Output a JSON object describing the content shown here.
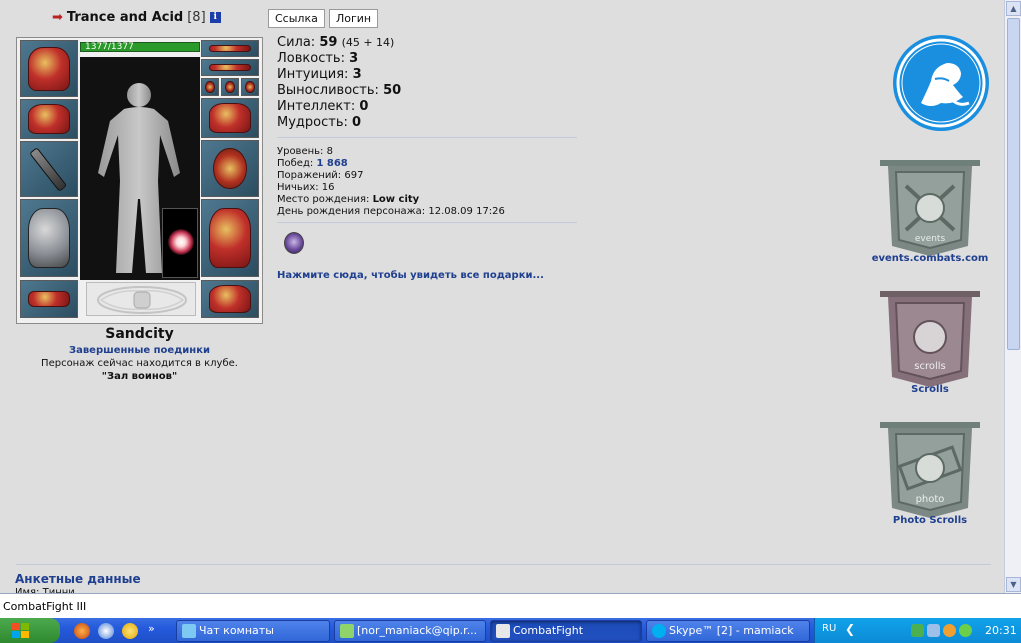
{
  "header": {
    "name": "Trance and Acid",
    "level": "[8]",
    "info_glyph": "i",
    "link_button": "Ссылка",
    "login_button": "Логин"
  },
  "equipment": {
    "hp": "1377/1377"
  },
  "location": {
    "name": "Sandcity",
    "finished_fights": "Завершенные поединки",
    "status": "Персонаж сейчас находится в клубе.",
    "hall": "\"Зал воинов\""
  },
  "stats": [
    {
      "label": "Сила:",
      "value": "59",
      "extra": "(45 + 14)"
    },
    {
      "label": "Ловкость:",
      "value": "3",
      "extra": ""
    },
    {
      "label": "Интуиция:",
      "value": "3",
      "extra": ""
    },
    {
      "label": "Выносливость:",
      "value": "50",
      "extra": ""
    },
    {
      "label": "Интеллект:",
      "value": "0",
      "extra": ""
    },
    {
      "label": "Мудрость:",
      "value": "0",
      "extra": ""
    }
  ],
  "info": {
    "level_label": "Уровень:",
    "level_value": "8",
    "wins_label": "Побед:",
    "wins_value": "1 868",
    "losses_label": "Поражений:",
    "losses_value": "697",
    "draws_label": "Ничьих:",
    "draws_value": "16",
    "birthplace_label": "Место рождения:",
    "birthplace_value": "Low city",
    "birthday_label": "День рождения персонажа:",
    "birthday_value": "12.08.09 17:26"
  },
  "gifts_link": "Нажмите сюда, чтобы увидеть все подарки...",
  "banners": {
    "events_text": "events",
    "events_label": "events.combats.com",
    "scrolls_text": "scrolls",
    "scrolls_label": "Scrolls",
    "photo_text": "photo",
    "photo_label": "Photo Scrolls"
  },
  "profile": {
    "title": "Анкетные данные",
    "first_line": "Имя: Тинни"
  },
  "window_title": "CombatFight III",
  "taskbar": {
    "tasks": [
      {
        "label": "Чат комнаты"
      },
      {
        "label": "[nor_maniack@qip.r..."
      },
      {
        "label": "CombatFight"
      },
      {
        "label": "Skype™ [2] - mamiack"
      }
    ],
    "lang": "RU",
    "clock": "20:31"
  },
  "colors": {
    "link": "#1f3f8f",
    "hp_bar": "#2a9a2a",
    "logo_blue": "#1a8fe0",
    "taskbar": "#245adc"
  }
}
